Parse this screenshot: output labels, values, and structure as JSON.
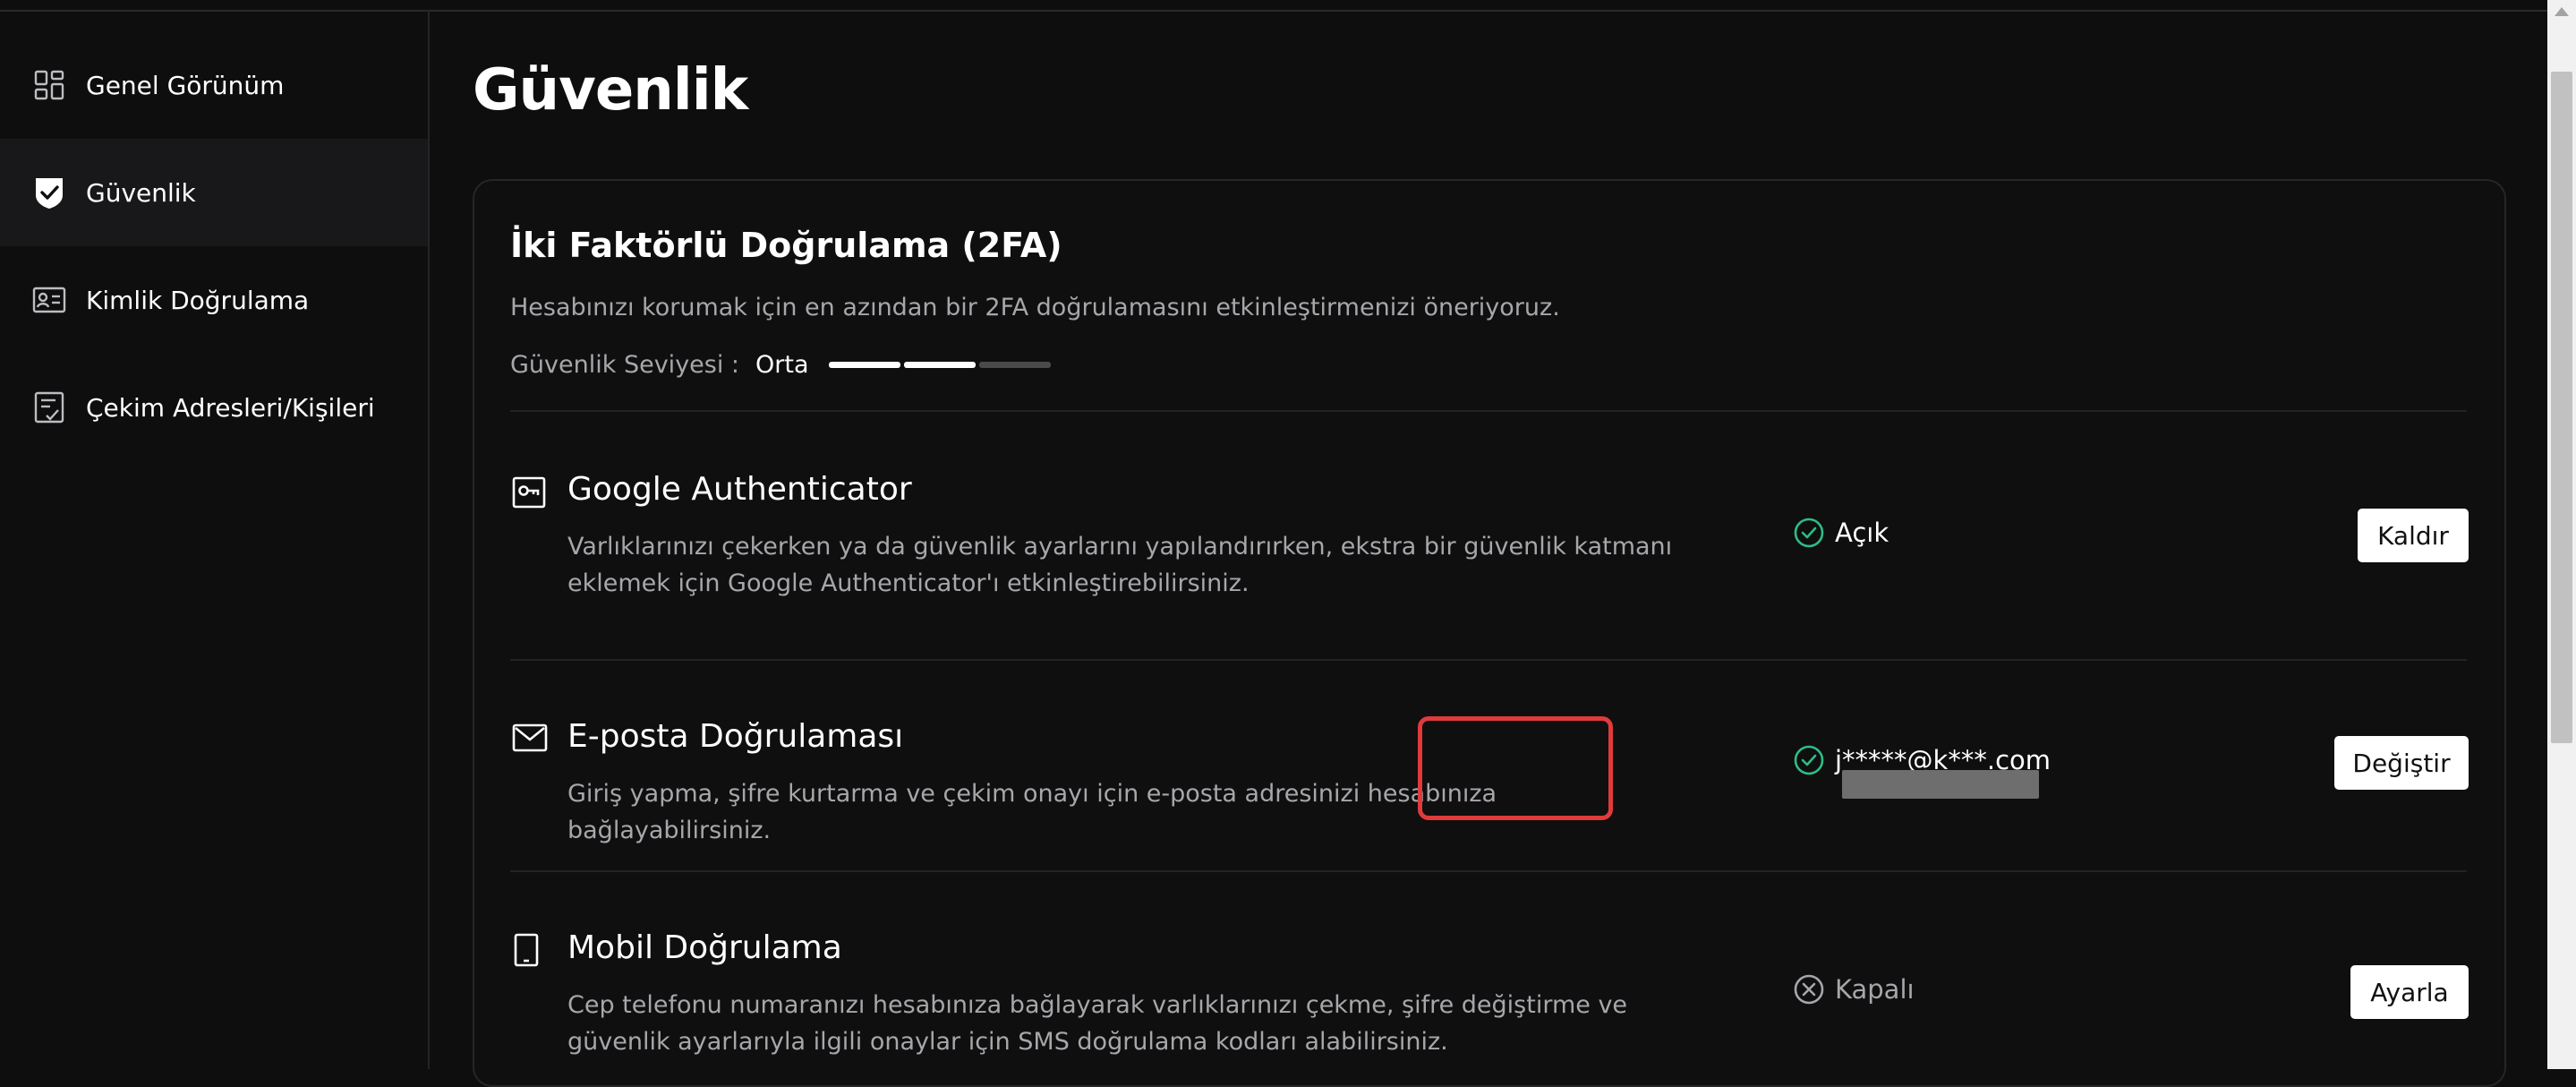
{
  "sidebar": {
    "items": [
      {
        "label": "Genel Görünüm",
        "icon": "dashboard-icon"
      },
      {
        "label": "Güvenlik",
        "icon": "shield-check-icon",
        "active": true
      },
      {
        "label": "Kimlik Doğrulama",
        "icon": "id-card-icon"
      },
      {
        "label": "Çekim Adresleri/Kişileri",
        "icon": "checklist-icon"
      }
    ]
  },
  "page": {
    "title": "Güvenlik"
  },
  "twofa": {
    "title": "İki Faktörlü Doğrulama (2FA)",
    "description": "Hesabınızı korumak için en azından bir 2FA doğrulamasını etkinleştirmenizi öneriyoruz.",
    "level_label": "Güvenlik Seviyesi :",
    "level_value": "Orta",
    "level_filled": 2,
    "level_total": 3
  },
  "methods": [
    {
      "title": "Google Authenticator",
      "description": "Varlıklarınızı çekerken ya da güvenlik ayarlarını yapılandırırken, ekstra bir güvenlik katmanı eklemek için Google Authenticator'ı etkinleştirebilirsiniz.",
      "icon": "key-icon",
      "status": "Açık",
      "status_on": true,
      "button": "Kaldır"
    },
    {
      "title": "E-posta Doğrulaması",
      "description": "Giriş yapma, şifre kurtarma ve çekim onayı için e-posta adresinizi hesabınıza bağlayabilirsiniz.",
      "icon": "mail-icon",
      "status": "j*****@k***.com",
      "status_on": true,
      "button": "Değiştir"
    },
    {
      "title": "Mobil Doğrulama",
      "description": "Cep telefonu numaranızı hesabınıza bağlayarak varlıklarınızı çekme, şifre değiştirme ve güvenlik ayarlarıyla ilgili onaylar için SMS doğrulama kodları alabilirsiniz.",
      "icon": "phone-icon",
      "status": "Kapalı",
      "status_on": false,
      "button": "Ayarla"
    }
  ],
  "colors": {
    "background": "#0e0e0f",
    "success": "#2ebd85",
    "highlight": "#e03b3b",
    "muted": "#a7a7ab"
  }
}
